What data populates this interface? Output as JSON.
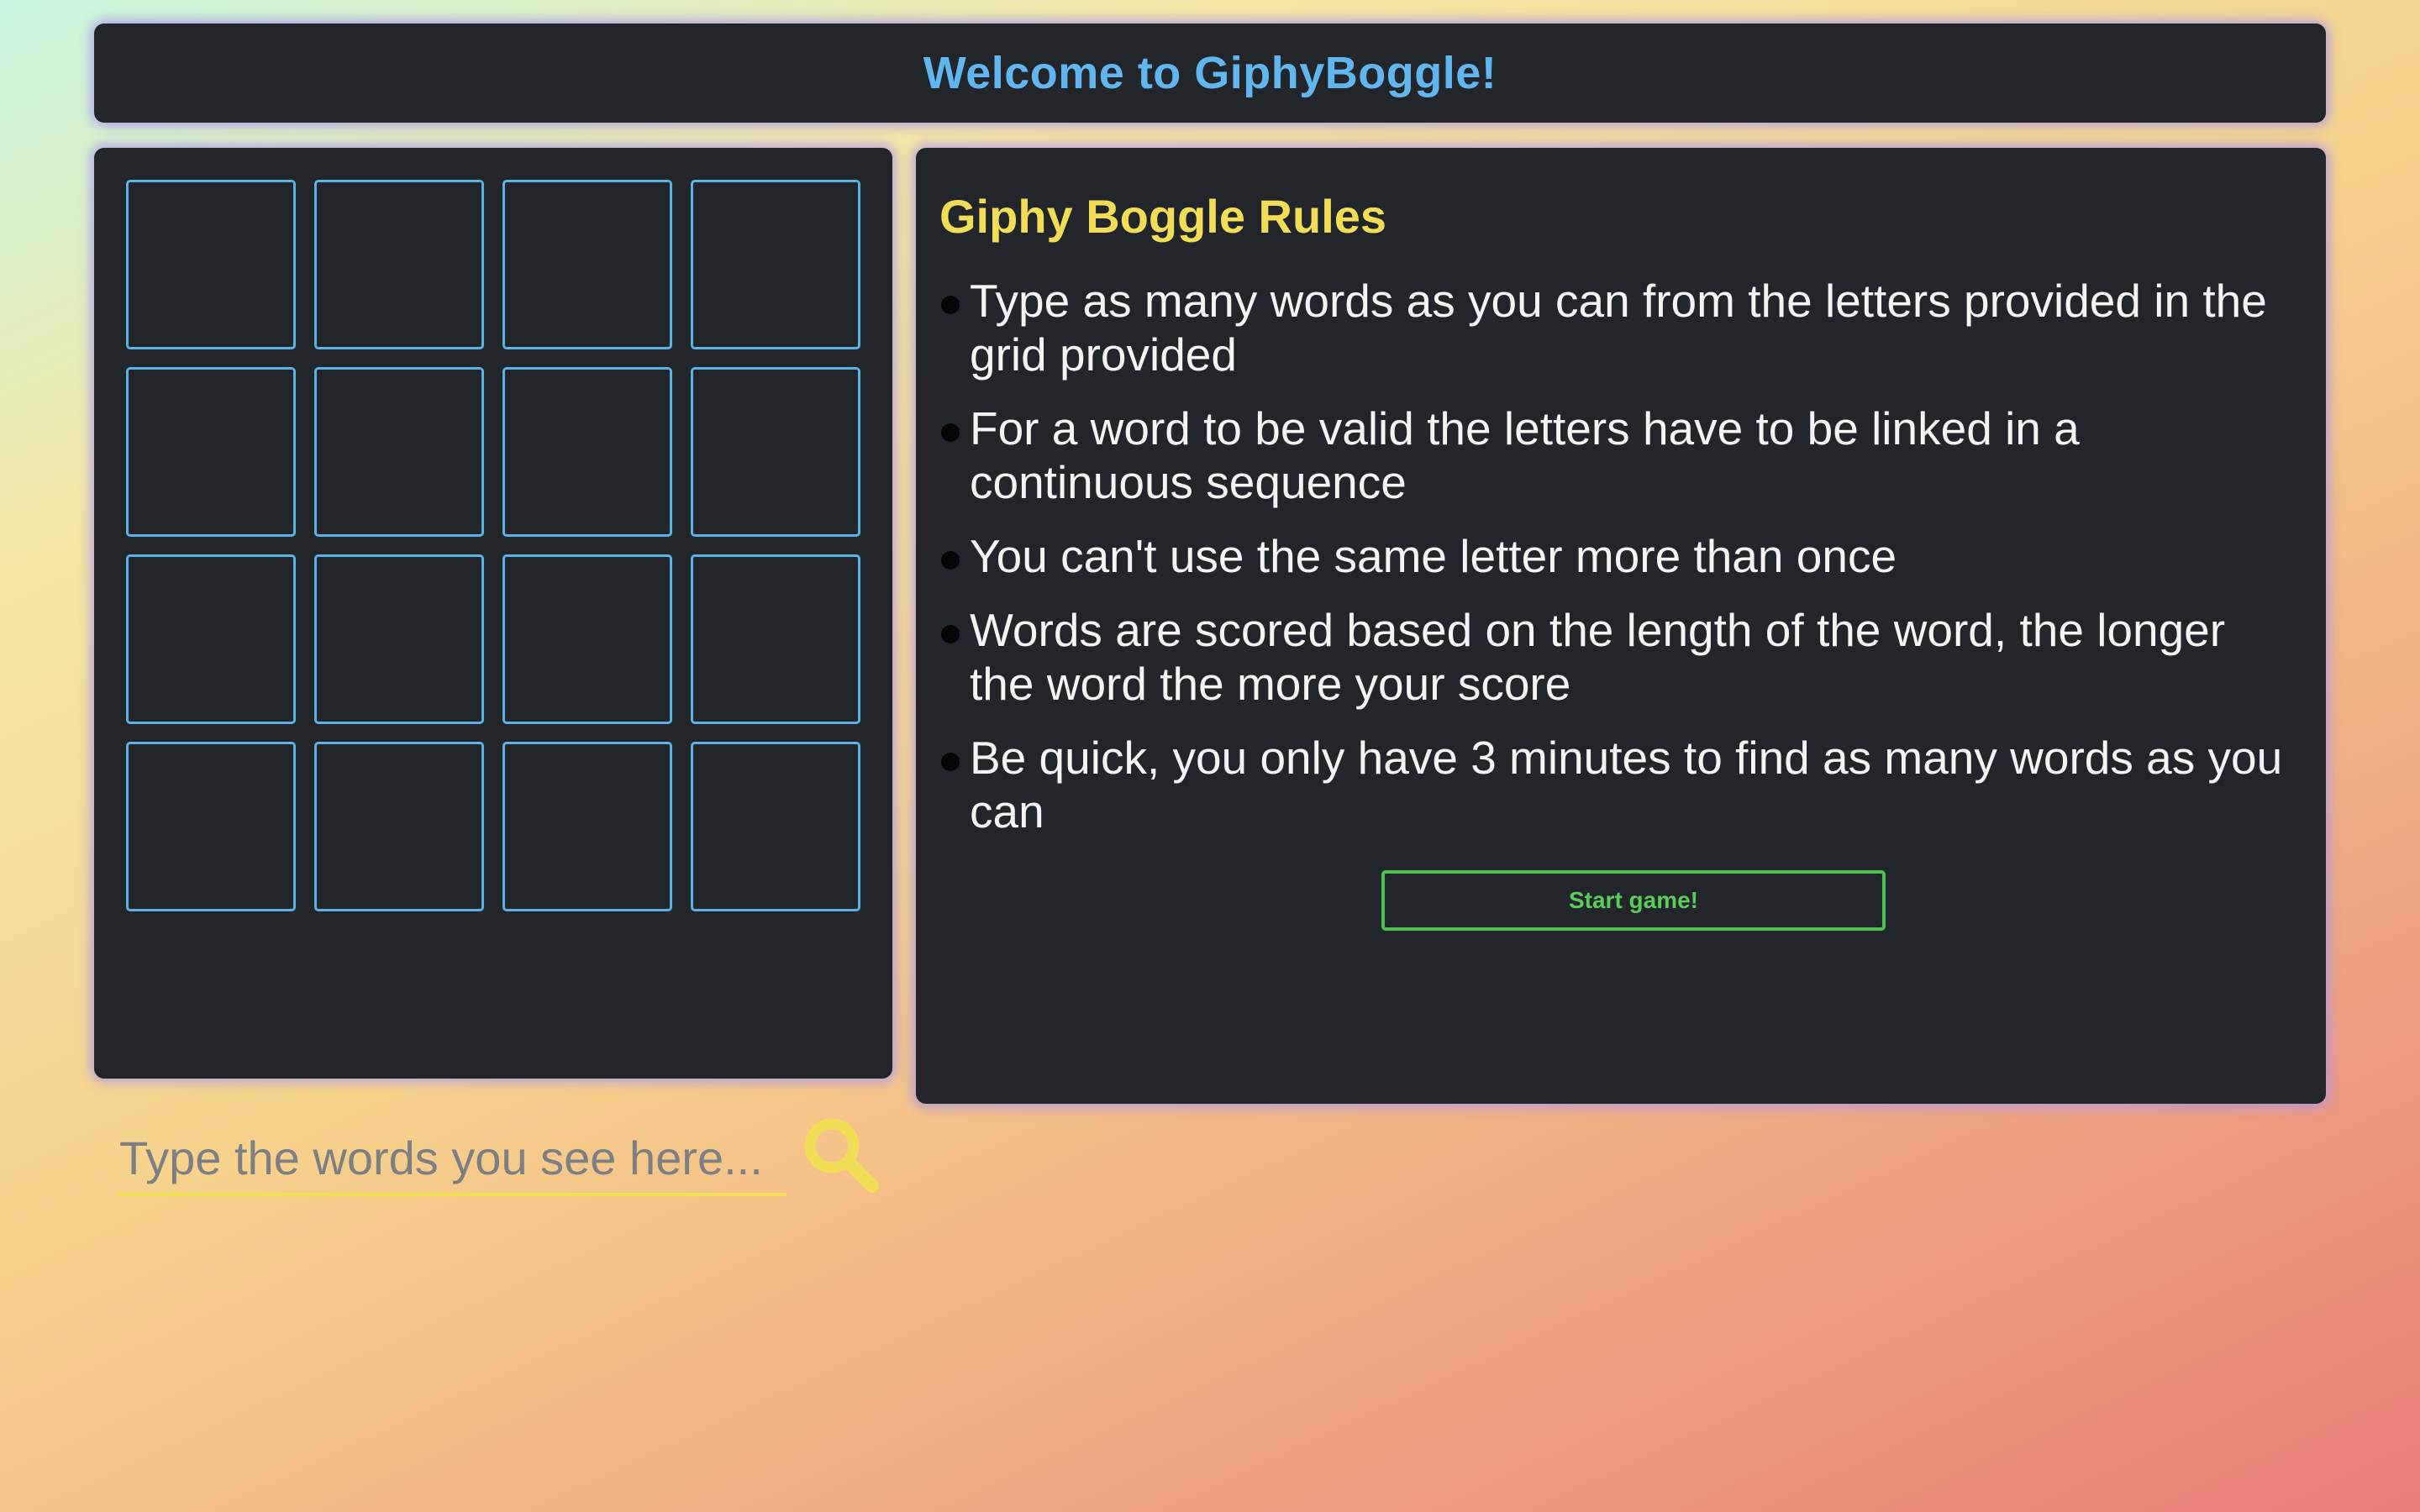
{
  "header": {
    "title": "Welcome to GiphyBoggle!"
  },
  "board": {
    "rows": 4,
    "columns": 4,
    "cells": [
      "",
      "",
      "",
      "",
      "",
      "",
      "",
      "",
      "",
      "",
      "",
      "",
      "",
      "",
      "",
      ""
    ],
    "input_value": "",
    "input_placeholder": "Type the words you see here...",
    "search_icon": "search-icon"
  },
  "rules": {
    "title": "Giphy Boggle Rules",
    "items": [
      "Type as many words as you can from the letters provided in the grid provided",
      "For a word to be valid the letters have to be linked in a continuous sequence",
      "You can't use the same letter more than once",
      "Words are scored based on the length of the word, the longer the word the more your score",
      "Be quick, you only have 3 minutes to find as many words as you can"
    ],
    "start_label": "Start game!"
  },
  "colors": {
    "panel_bg": "#22262b",
    "header_text": "#62b6ef",
    "rules_title": "#f2de56",
    "cell_border": "#5bb2e3",
    "input_underline": "#f2e156",
    "start_button": "#4fc14f",
    "panel_glow": "#aa96eb"
  }
}
